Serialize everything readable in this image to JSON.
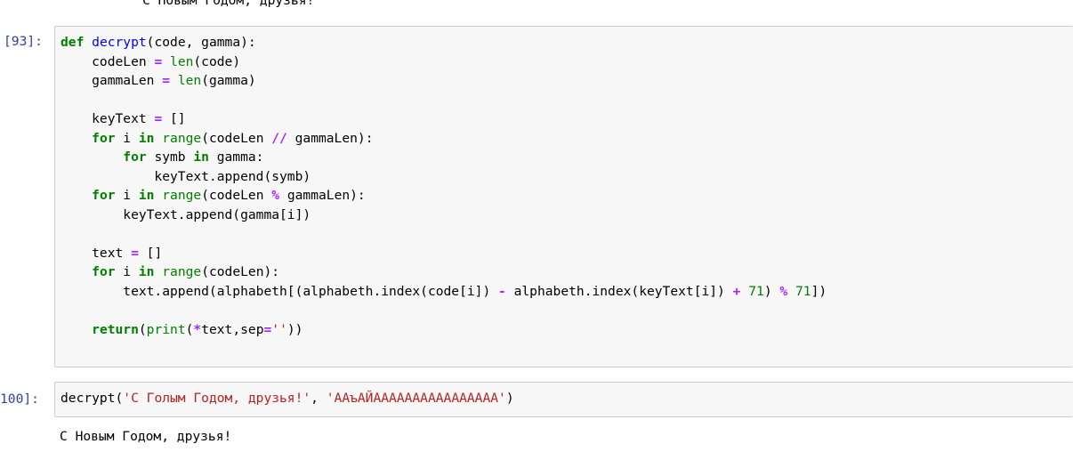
{
  "previous_output": "С Новым Годом, друзья!",
  "cell1": {
    "prompt": "[93]:",
    "lines": [
      [
        [
          "kw",
          "def"
        ],
        [
          "t",
          " "
        ],
        [
          "fn",
          "decrypt"
        ],
        [
          "t",
          "(code, gamma):"
        ]
      ],
      [
        [
          "t",
          "    codeLen "
        ],
        [
          "op",
          "="
        ],
        [
          "t",
          " "
        ],
        [
          "bi",
          "len"
        ],
        [
          "t",
          "(code)"
        ]
      ],
      [
        [
          "t",
          "    gammaLen "
        ],
        [
          "op",
          "="
        ],
        [
          "t",
          " "
        ],
        [
          "bi",
          "len"
        ],
        [
          "t",
          "(gamma)"
        ]
      ],
      [],
      [
        [
          "t",
          "    keyText "
        ],
        [
          "op",
          "="
        ],
        [
          "t",
          " []"
        ]
      ],
      [
        [
          "t",
          "    "
        ],
        [
          "kw",
          "for"
        ],
        [
          "t",
          " i "
        ],
        [
          "kw",
          "in"
        ],
        [
          "t",
          " "
        ],
        [
          "bi",
          "range"
        ],
        [
          "t",
          "(codeLen "
        ],
        [
          "op",
          "//"
        ],
        [
          "t",
          " gammaLen):"
        ]
      ],
      [
        [
          "t",
          "        "
        ],
        [
          "kw",
          "for"
        ],
        [
          "t",
          " symb "
        ],
        [
          "kw",
          "in"
        ],
        [
          "t",
          " gamma:"
        ]
      ],
      [
        [
          "t",
          "            keyText.append(symb)"
        ]
      ],
      [
        [
          "t",
          "    "
        ],
        [
          "kw",
          "for"
        ],
        [
          "t",
          " i "
        ],
        [
          "kw",
          "in"
        ],
        [
          "t",
          " "
        ],
        [
          "bi",
          "range"
        ],
        [
          "t",
          "(codeLen "
        ],
        [
          "op",
          "%"
        ],
        [
          "t",
          " gammaLen):"
        ]
      ],
      [
        [
          "t",
          "        keyText.append(gamma[i])"
        ]
      ],
      [],
      [
        [
          "t",
          "    text "
        ],
        [
          "op",
          "="
        ],
        [
          "t",
          " []"
        ]
      ],
      [
        [
          "t",
          "    "
        ],
        [
          "kw",
          "for"
        ],
        [
          "t",
          " i "
        ],
        [
          "kw",
          "in"
        ],
        [
          "t",
          " "
        ],
        [
          "bi",
          "range"
        ],
        [
          "t",
          "(codeLen):"
        ]
      ],
      [
        [
          "t",
          "        text.append(alphabeth[(alphabeth.index(code[i]) "
        ],
        [
          "op",
          "-"
        ],
        [
          "t",
          " alphabeth.index(keyText[i]) "
        ],
        [
          "op",
          "+"
        ],
        [
          "t",
          " "
        ],
        [
          "num",
          "71"
        ],
        [
          "t",
          ") "
        ],
        [
          "op",
          "%"
        ],
        [
          "t",
          " "
        ],
        [
          "num",
          "71"
        ],
        [
          "t",
          "])"
        ]
      ],
      [],
      [
        [
          "t",
          "    "
        ],
        [
          "kw",
          "return"
        ],
        [
          "t",
          "("
        ],
        [
          "bi",
          "print"
        ],
        [
          "t",
          "("
        ],
        [
          "op",
          "*"
        ],
        [
          "t",
          "text,sep"
        ],
        [
          "op",
          "="
        ],
        [
          "str",
          "''"
        ],
        [
          "t",
          "))"
        ]
      ]
    ]
  },
  "cell2": {
    "prompt": "100]:",
    "lines": [
      [
        [
          "t",
          "decrypt("
        ],
        [
          "str",
          "'С Голым Годом, друзья!'"
        ],
        [
          "t",
          ", "
        ],
        [
          "str",
          "'ААъАЙАААААААААААААААА'"
        ],
        [
          "t",
          ")"
        ]
      ]
    ],
    "output": "С Новым Годом, друзья!"
  }
}
